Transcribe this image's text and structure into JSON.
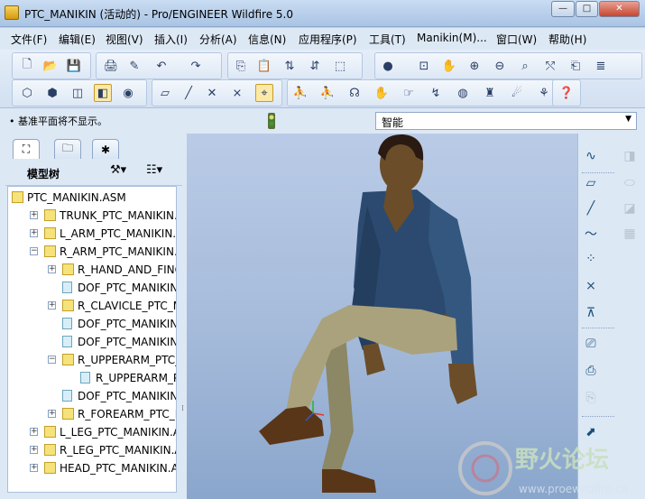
{
  "window": {
    "title": "PTC_MANIKIN (活动的) - Pro/ENGINEER Wildfire 5.0",
    "minimize": "—",
    "maximize": "□",
    "close": "✕"
  },
  "menubar": [
    "文件(F)",
    "编辑(E)",
    "视图(V)",
    "插入(I)",
    "分析(A)",
    "信息(N)",
    "应用程序(P)",
    "工具(T)",
    "Manikin(M)...",
    "窗口(W)",
    "帮助(H)"
  ],
  "toolbar": {
    "row1_icons": [
      "new-icon",
      "open-icon",
      "save-icon",
      "print-icon",
      "email-icon",
      "undo-icon",
      "redo-icon",
      "copy-icon",
      "paste-icon",
      "regenerate-icon",
      "regenerate-manager-icon",
      "select-box-icon",
      "appearance-sphere-icon",
      "repaint-icon",
      "pan-icon",
      "zoom-in-icon",
      "zoom-out-icon",
      "refit-icon",
      "reorient-icon",
      "saved-views-icon",
      "layers-icon"
    ],
    "row2_icons": [
      "wireframe-icon",
      "hidden-line-icon",
      "no-hidden-icon",
      "shaded-icon",
      "enhanced-realism-icon",
      "plane-display-icon",
      "axis-display-icon",
      "point-display-icon",
      "csys-display-icon",
      "spin-center-icon",
      "anno-display-icon",
      "manikin-tool-1-icon",
      "manikin-tool-2-icon",
      "manikin-tool-3-icon",
      "manikin-tool-4-icon",
      "manikin-tool-5-icon",
      "manikin-tool-6-icon",
      "manikin-tool-7-icon",
      "manikin-tool-8-icon",
      "manikin-tool-9-icon",
      "context-help-icon"
    ]
  },
  "status": {
    "message": "• 基准平面将不显示。",
    "filter_value": "智能"
  },
  "model_tree": {
    "title": "模型树",
    "rows": [
      {
        "label": "PTC_MANIKIN.ASM",
        "level": 0,
        "icon": "asm",
        "expander": ""
      },
      {
        "label": "TRUNK_PTC_MANIKIN.A",
        "level": 1,
        "icon": "asm",
        "expander": "+"
      },
      {
        "label": "L_ARM_PTC_MANIKIN.A",
        "level": 1,
        "icon": "asm",
        "expander": "+"
      },
      {
        "label": "R_ARM_PTC_MANIKIN.A",
        "level": 1,
        "icon": "asm",
        "expander": "−"
      },
      {
        "label": "R_HAND_AND_FINGE",
        "level": 2,
        "icon": "asm",
        "expander": "+"
      },
      {
        "label": "DOF_PTC_MANIKIN",
        "level": 2,
        "icon": "dof",
        "expander": ""
      },
      {
        "label": "R_CLAVICLE_PTC_M",
        "level": 2,
        "icon": "asm",
        "expander": "+"
      },
      {
        "label": "DOF_PTC_MANIKIN",
        "level": 2,
        "icon": "dof",
        "expander": ""
      },
      {
        "label": "DOF_PTC_MANIKIN",
        "level": 2,
        "icon": "dof",
        "expander": ""
      },
      {
        "label": "R_UPPERARM_PTC_",
        "level": 2,
        "icon": "asm",
        "expander": "−"
      },
      {
        "label": "R_UPPERARM_PT",
        "level": 3,
        "icon": "dof",
        "expander": ""
      },
      {
        "label": "DOF_PTC_MANIKIN",
        "level": 2,
        "icon": "dof",
        "expander": ""
      },
      {
        "label": "R_FOREARM_PTC_M",
        "level": 2,
        "icon": "asm",
        "expander": "+"
      },
      {
        "label": "L_LEG_PTC_MANIKIN.AS",
        "level": 1,
        "icon": "asm",
        "expander": "+"
      },
      {
        "label": "R_LEG_PTC_MANIKIN.AS",
        "level": 1,
        "icon": "asm",
        "expander": "+"
      },
      {
        "label": "HEAD_PTC_MANIKIN.AS",
        "level": 1,
        "icon": "asm",
        "expander": "+"
      }
    ]
  },
  "right_toolbar_icons": [
    "sketch-icon",
    "plane-icon",
    "axis-icon",
    "curve-icon",
    "point-icon",
    "csys-icon",
    "analysis-icon",
    "mirror-icon",
    "merge-icon",
    "trim-icon",
    "pattern-icon",
    "offset-icon",
    "extend-icon"
  ],
  "watermark": {
    "text": "野火论坛",
    "url": "www.proewildfire.cn"
  }
}
